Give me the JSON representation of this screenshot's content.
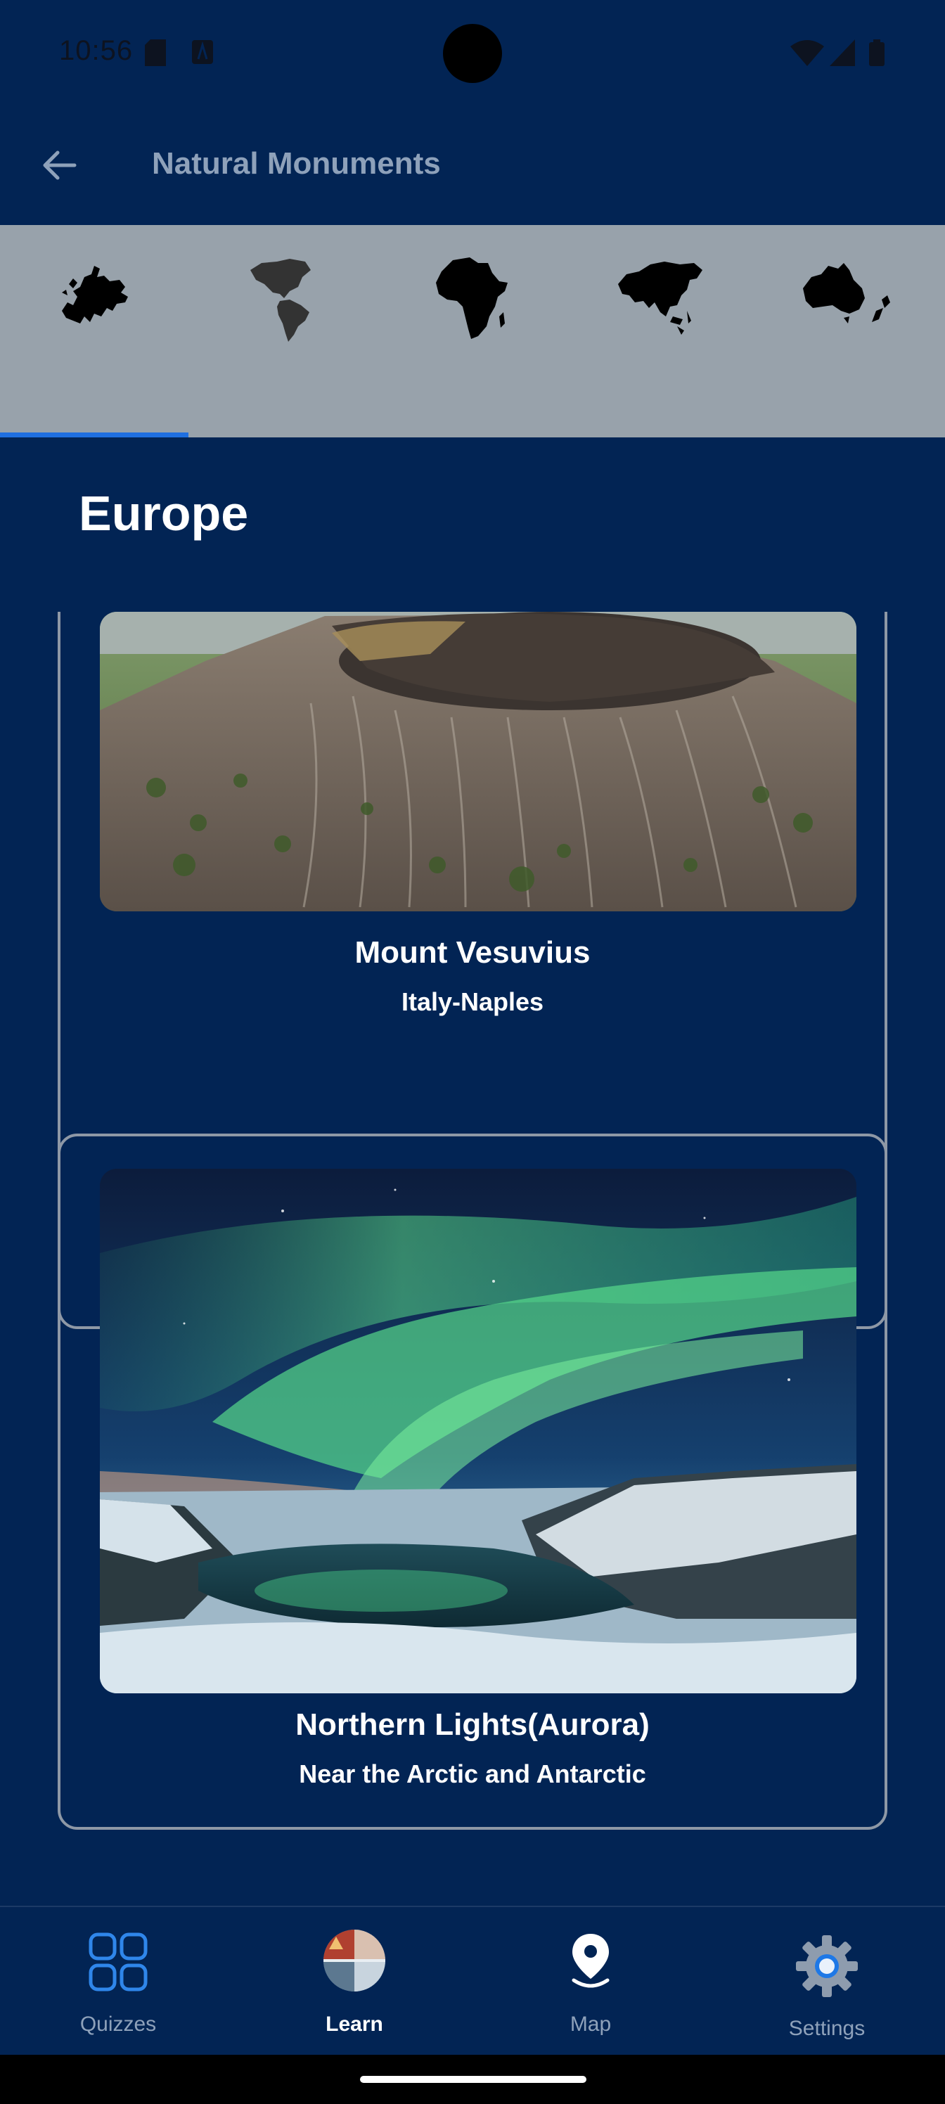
{
  "status_bar": {
    "time": "10:56"
  },
  "app_bar": {
    "title": "Natural Monuments"
  },
  "continent_tabs": [
    {
      "name": "Europe",
      "icon": "europe-map-icon",
      "selected": true
    },
    {
      "name": "Americas",
      "icon": "americas-map-icon",
      "selected": false
    },
    {
      "name": "Africa",
      "icon": "africa-map-icon",
      "selected": false
    },
    {
      "name": "Asia",
      "icon": "asia-map-icon",
      "selected": false
    },
    {
      "name": "Oceania",
      "icon": "oceania-map-icon",
      "selected": false
    }
  ],
  "section": {
    "title": "Europe"
  },
  "monuments": [
    {
      "name": "Mount Vesuvius",
      "location": "Italy-Naples"
    },
    {
      "name": "Northern Lights(Aurora)",
      "location": "Near the Arctic and Antarctic"
    }
  ],
  "bottom_nav": [
    {
      "label": "Quizzes",
      "icon": "grid-icon",
      "active": false
    },
    {
      "label": "Learn",
      "icon": "learn-photo-icon",
      "active": true
    },
    {
      "label": "Map",
      "icon": "map-pin-icon",
      "active": false
    },
    {
      "label": "Settings",
      "icon": "gear-icon",
      "active": false
    }
  ],
  "colors": {
    "background": "#022454",
    "tab_bar": "#98a2ab",
    "tab_indicator": "#1f6fe0",
    "card_border": "#8e98a6",
    "nav_active": "#ffffff",
    "nav_inactive": "#8ea1ba"
  }
}
